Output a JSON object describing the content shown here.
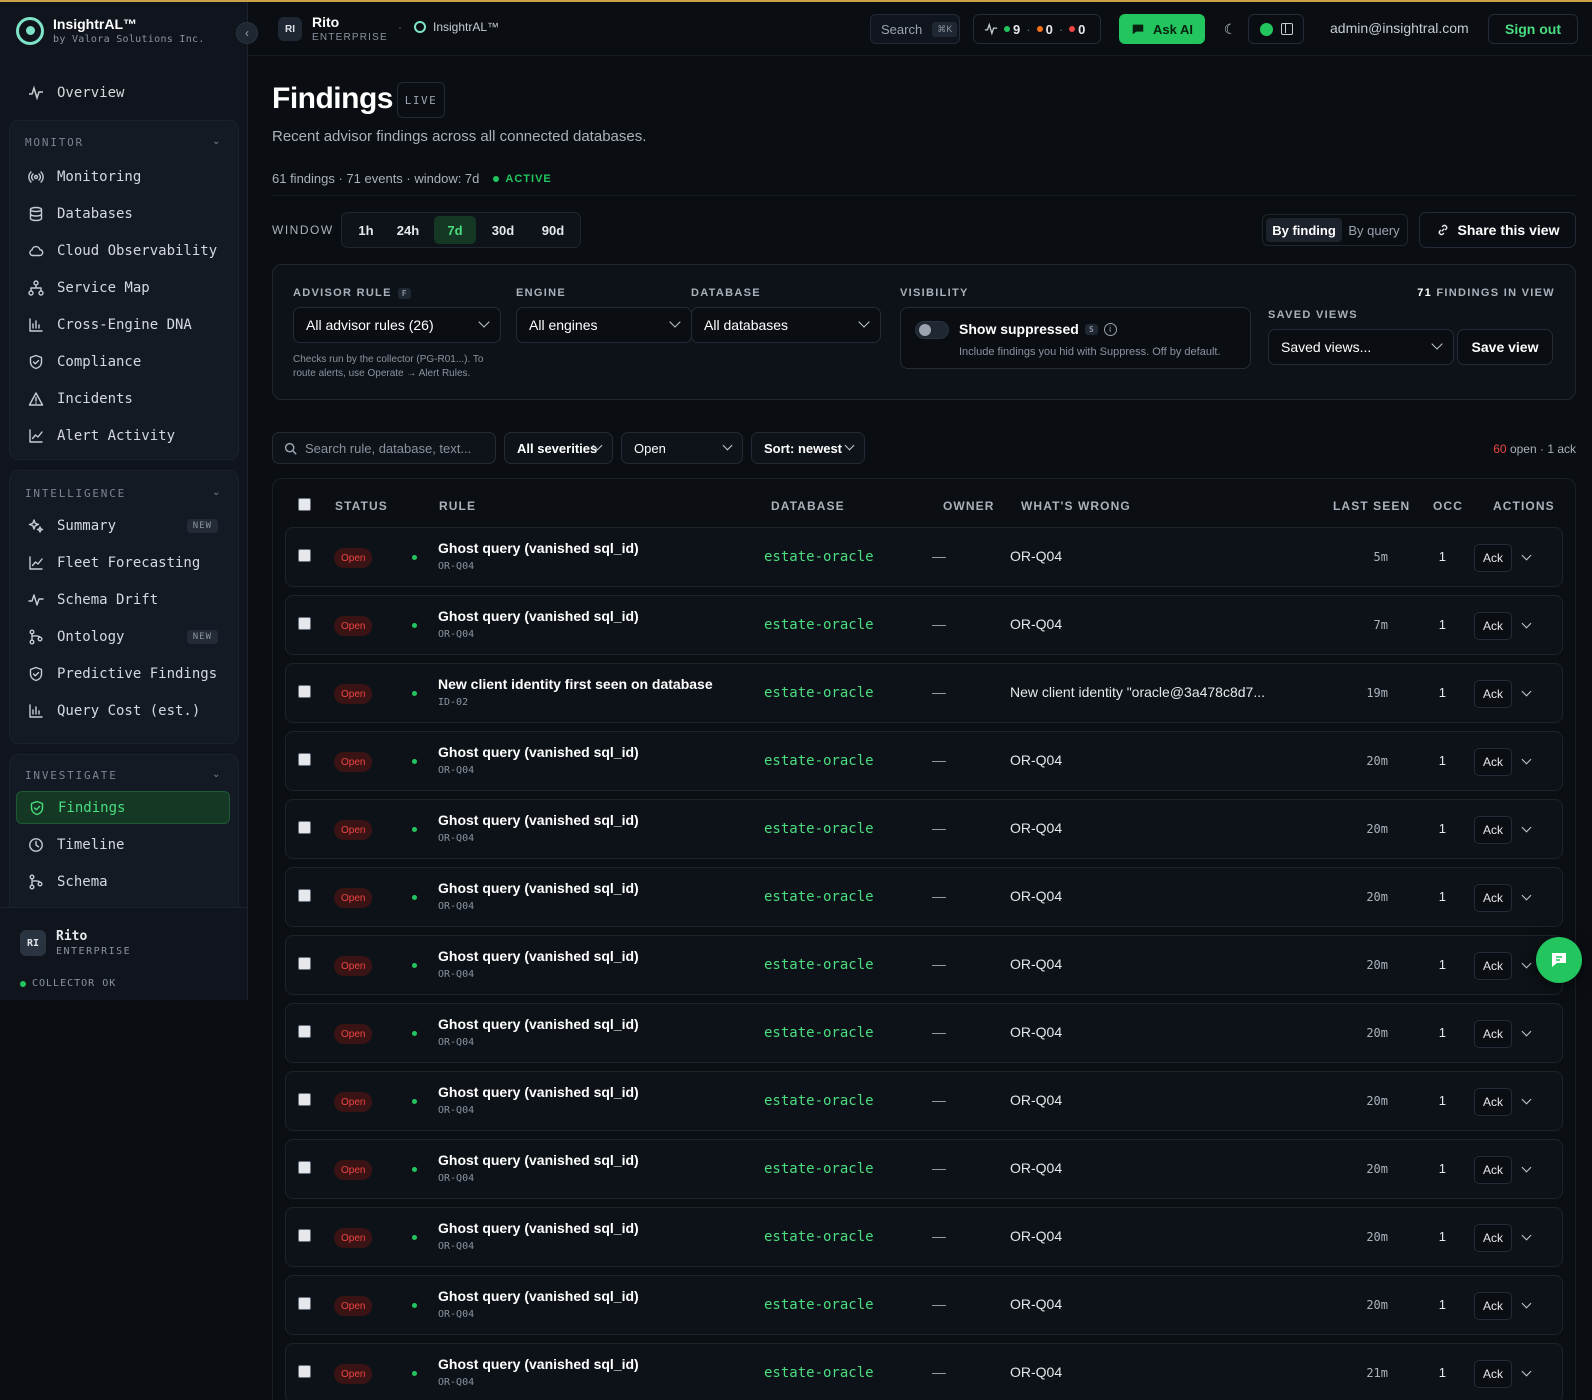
{
  "brand": {
    "name": "InsightrAL™",
    "sub": "by Valora Solutions Inc."
  },
  "sidebar": {
    "overview": "Overview",
    "monitor": {
      "title": "MONITOR",
      "items": [
        {
          "label": "Monitoring",
          "icon": "signal-icon"
        },
        {
          "label": "Databases",
          "icon": "database-icon"
        },
        {
          "label": "Cloud Observability",
          "icon": "cloud-icon"
        },
        {
          "label": "Service Map",
          "icon": "network-icon"
        },
        {
          "label": "Cross-Engine DNA",
          "icon": "bar-chart-icon"
        },
        {
          "label": "Compliance",
          "icon": "shield-icon"
        },
        {
          "label": "Incidents",
          "icon": "warning-icon"
        },
        {
          "label": "Alert Activity",
          "icon": "line-chart-icon"
        }
      ]
    },
    "intelligence": {
      "title": "INTELLIGENCE",
      "items": [
        {
          "label": "Summary",
          "icon": "sparkles-icon",
          "badge": "NEW"
        },
        {
          "label": "Fleet Forecasting",
          "icon": "line-chart-icon"
        },
        {
          "label": "Schema Drift",
          "icon": "pulse-icon"
        },
        {
          "label": "Ontology",
          "icon": "branch-icon",
          "badge": "NEW"
        },
        {
          "label": "Predictive Findings",
          "icon": "shield-icon"
        },
        {
          "label": "Query Cost (est.)",
          "icon": "bar-chart-icon"
        }
      ]
    },
    "investigate": {
      "title": "INVESTIGATE",
      "items": [
        {
          "label": "Findings",
          "icon": "shield-icon"
        },
        {
          "label": "Timeline",
          "icon": "clock-icon"
        },
        {
          "label": "Schema",
          "icon": "branch-icon"
        }
      ]
    },
    "footer": {
      "avatar": "RI",
      "name": "Rito",
      "plan": "ENTERPRISE",
      "status": "COLLECTOR OK"
    }
  },
  "header": {
    "avatar": "RI",
    "org": "Rito",
    "plan": "ENTERPRISE",
    "sep": "·",
    "product": "InsightrAL™",
    "search": "Search",
    "shortcut": "⌘K",
    "stats": {
      "green": "9",
      "orange": "0",
      "red": "0",
      "sep": "·"
    },
    "ask_ai": "Ask AI",
    "email": "admin@insightral.com",
    "sign_out": "Sign out"
  },
  "page": {
    "title": "Findings",
    "live": "LIVE",
    "subtitle": "Recent advisor findings across all connected databases.",
    "meta": "61 findings · 71 events · window: 7d",
    "active": "ACTIVE"
  },
  "window": {
    "label": "WINDOW",
    "options": [
      "1h",
      "24h",
      "7d",
      "30d",
      "90d"
    ],
    "selected": "7d"
  },
  "view_toggle": {
    "by_finding": "By finding",
    "by_query": "By query"
  },
  "share": "Share this view",
  "filters": {
    "advisor_rule": {
      "label": "ADVISOR RULE",
      "kbd": "F",
      "value": "All advisor rules (26)",
      "help": "Checks run by the collector (PG-R01...). To route alerts, use Operate → Alert Rules."
    },
    "engine": {
      "label": "ENGINE",
      "value": "All engines"
    },
    "database": {
      "label": "DATABASE",
      "value": "All databases"
    },
    "visibility": {
      "label": "VISIBILITY",
      "title": "Show suppressed",
      "kbd": "S",
      "info": "i",
      "help": "Include findings you hid with Suppress. Off by default."
    },
    "count": {
      "num": "71",
      "text": "FINDINGS IN VIEW"
    },
    "saved": {
      "label": "SAVED VIEWS",
      "value": "Saved views...",
      "save": "Save view"
    }
  },
  "toolbar": {
    "search_placeholder": "Search rule, database, text...",
    "severity": "All severities",
    "status": "Open",
    "sort": "Sort: newest",
    "open_count": "60",
    "rest": "open · 1 ack"
  },
  "table": {
    "columns": {
      "status": "STATUS",
      "rule": "RULE",
      "database": "DATABASE",
      "owner": "OWNER",
      "wrong": "WHAT'S WRONG",
      "last_seen": "LAST SEEN",
      "occ": "OCC",
      "actions": "ACTIONS"
    },
    "rows": [
      {
        "status": "Open",
        "title": "Ghost query (vanished sql_id)",
        "code": "OR-Q04",
        "db": "estate-oracle",
        "owner": "—",
        "wrong": "OR-Q04",
        "last": "5m",
        "occ": "1",
        "ack": "Ack"
      },
      {
        "status": "Open",
        "title": "Ghost query (vanished sql_id)",
        "code": "OR-Q04",
        "db": "estate-oracle",
        "owner": "—",
        "wrong": "OR-Q04",
        "last": "7m",
        "occ": "1",
        "ack": "Ack"
      },
      {
        "status": "Open",
        "title": "New client identity first seen on database",
        "code": "ID-02",
        "db": "estate-oracle",
        "owner": "—",
        "wrong": "New client identity \"oracle@3a478c8d7...",
        "last": "19m",
        "occ": "1",
        "ack": "Ack"
      },
      {
        "status": "Open",
        "title": "Ghost query (vanished sql_id)",
        "code": "OR-Q04",
        "db": "estate-oracle",
        "owner": "—",
        "wrong": "OR-Q04",
        "last": "20m",
        "occ": "1",
        "ack": "Ack"
      },
      {
        "status": "Open",
        "title": "Ghost query (vanished sql_id)",
        "code": "OR-Q04",
        "db": "estate-oracle",
        "owner": "—",
        "wrong": "OR-Q04",
        "last": "20m",
        "occ": "1",
        "ack": "Ack"
      },
      {
        "status": "Open",
        "title": "Ghost query (vanished sql_id)",
        "code": "OR-Q04",
        "db": "estate-oracle",
        "owner": "—",
        "wrong": "OR-Q04",
        "last": "20m",
        "occ": "1",
        "ack": "Ack"
      },
      {
        "status": "Open",
        "title": "Ghost query (vanished sql_id)",
        "code": "OR-Q04",
        "db": "estate-oracle",
        "owner": "—",
        "wrong": "OR-Q04",
        "last": "20m",
        "occ": "1",
        "ack": "Ack"
      },
      {
        "status": "Open",
        "title": "Ghost query (vanished sql_id)",
        "code": "OR-Q04",
        "db": "estate-oracle",
        "owner": "—",
        "wrong": "OR-Q04",
        "last": "20m",
        "occ": "1",
        "ack": "Ack"
      },
      {
        "status": "Open",
        "title": "Ghost query (vanished sql_id)",
        "code": "OR-Q04",
        "db": "estate-oracle",
        "owner": "—",
        "wrong": "OR-Q04",
        "last": "20m",
        "occ": "1",
        "ack": "Ack"
      },
      {
        "status": "Open",
        "title": "Ghost query (vanished sql_id)",
        "code": "OR-Q04",
        "db": "estate-oracle",
        "owner": "—",
        "wrong": "OR-Q04",
        "last": "20m",
        "occ": "1",
        "ack": "Ack"
      },
      {
        "status": "Open",
        "title": "Ghost query (vanished sql_id)",
        "code": "OR-Q04",
        "db": "estate-oracle",
        "owner": "—",
        "wrong": "OR-Q04",
        "last": "20m",
        "occ": "1",
        "ack": "Ack"
      },
      {
        "status": "Open",
        "title": "Ghost query (vanished sql_id)",
        "code": "OR-Q04",
        "db": "estate-oracle",
        "owner": "—",
        "wrong": "OR-Q04",
        "last": "20m",
        "occ": "1",
        "ack": "Ack"
      },
      {
        "status": "Open",
        "title": "Ghost query (vanished sql_id)",
        "code": "OR-Q04",
        "db": "estate-oracle",
        "owner": "—",
        "wrong": "OR-Q04",
        "last": "21m",
        "occ": "1",
        "ack": "Ack"
      }
    ]
  },
  "colors": {
    "accent": "#22c55e",
    "open": "#ef4444",
    "orange": "#f97316"
  }
}
